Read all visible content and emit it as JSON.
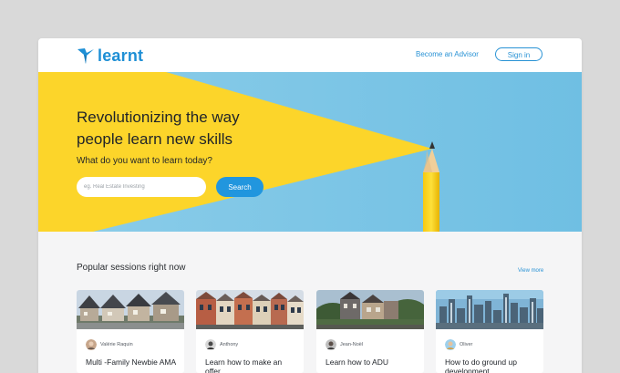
{
  "header": {
    "brand": "learnt",
    "advisor_link": "Become an Advisor",
    "signin_label": "Sign in"
  },
  "hero": {
    "title": "Revolutionizing the way people learn new skills",
    "subtitle": "What do you want to learn today?",
    "search_placeholder": "eg. Real Estate Investing",
    "search_button": "Search"
  },
  "sessions": {
    "heading": "Popular sessions right now",
    "view_more": "View more",
    "cards": [
      {
        "author": "Valérie Raquin",
        "title": "Multi -Family Newbie AMA",
        "image": "suburban-houses"
      },
      {
        "author": "Anthony",
        "title": "Learn how to make an offer",
        "image": "townhouses"
      },
      {
        "author": "Jean-Noël",
        "title": "Learn how to ADU",
        "image": "neighborhood"
      },
      {
        "author": "Oliver",
        "title": "How to do ground up development",
        "image": "city-skyline"
      }
    ]
  },
  "colors": {
    "brand": "#1e8fd5",
    "primary_button": "#2196de",
    "hero_sky": "#7ec6e6",
    "hero_yellow": "#fcd52a",
    "page_background": "#f5f5f6"
  }
}
